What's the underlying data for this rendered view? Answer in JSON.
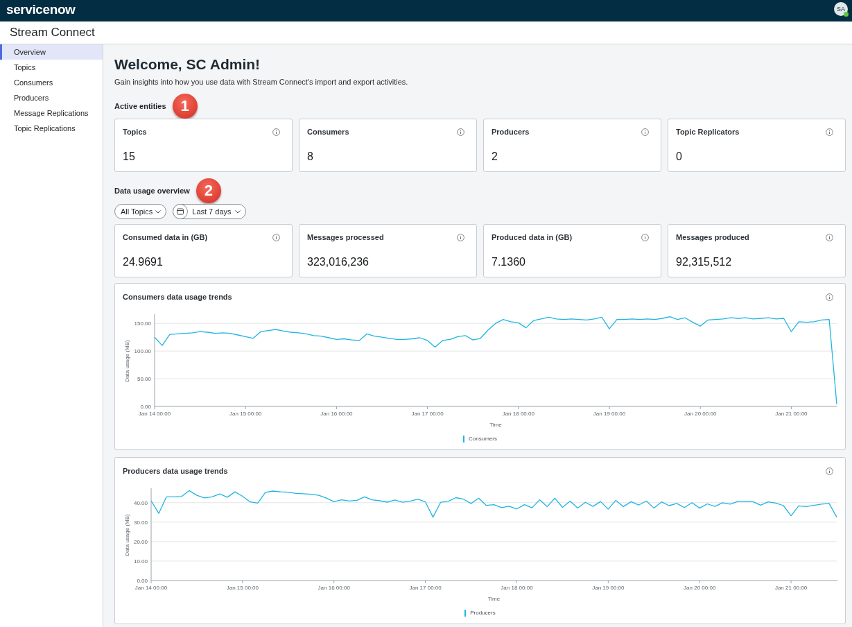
{
  "top_bar": {
    "logo": "servicenow",
    "avatar": {
      "initials": "SA",
      "online": true
    }
  },
  "app_header": {
    "title": "Stream Connect"
  },
  "sidebar": {
    "items": [
      {
        "label": "Overview",
        "selected": true
      },
      {
        "label": "Topics",
        "selected": false
      },
      {
        "label": "Consumers",
        "selected": false
      },
      {
        "label": "Producers",
        "selected": false
      },
      {
        "label": "Message Replications",
        "selected": false
      },
      {
        "label": "Topic Replications",
        "selected": false
      }
    ]
  },
  "main": {
    "title": "Welcome, SC Admin!",
    "subtitle": "Gain insights into how you use data with Stream Connect's import and export activities.",
    "sections": [
      {
        "heading": "Active entities",
        "callout": "1",
        "cards": [
          {
            "label": "Topics",
            "value": "15"
          },
          {
            "label": "Consumers",
            "value": "8"
          },
          {
            "label": "Producers",
            "value": "2"
          },
          {
            "label": "Topic Replicators",
            "value": "0"
          }
        ]
      },
      {
        "heading": "Data usage overview",
        "callout": "2",
        "filters": [
          {
            "kind": "dropdown",
            "label": "All Topics"
          },
          {
            "kind": "date",
            "label": "Last 7 days"
          }
        ],
        "cards": [
          {
            "label": "Consumed data in (GB)",
            "value": "24.9691"
          },
          {
            "label": "Messages processed",
            "value": "323,016,236"
          },
          {
            "label": "Produced data in (GB)",
            "value": "7.1360"
          },
          {
            "label": "Messages produced",
            "value": "92,315,512"
          }
        ],
        "charts": [
          {
            "chart_data": {
              "type": "line",
              "title": "Consumers data usage trends",
              "xlabel": "Time",
              "ylabel": "Data usage (MB)",
              "grid": true,
              "categories": [
                "Jan 14 00:00",
                null,
                null,
                null,
                null,
                null,
                null,
                null,
                null,
                null,
                null,
                null,
                "Jan 15 00:00",
                null,
                null,
                null,
                null,
                null,
                null,
                null,
                null,
                null,
                null,
                null,
                "Jan 16 00:00",
                null,
                null,
                null,
                null,
                null,
                null,
                null,
                null,
                null,
                null,
                null,
                "Jan 17 00:00",
                null,
                null,
                null,
                null,
                null,
                null,
                null,
                null,
                null,
                null,
                null,
                "Jan 18 00:00",
                null,
                null,
                null,
                null,
                null,
                null,
                null,
                null,
                null,
                null,
                null,
                "Jan 19 00:00",
                null,
                null,
                null,
                null,
                null,
                null,
                null,
                null,
                null,
                null,
                null,
                "Jan 20 00:00",
                null,
                null,
                null,
                null,
                null,
                null,
                null,
                null,
                null,
                null,
                null,
                "Jan 21 00:00",
                null,
                null,
                null,
                null,
                null,
                null
              ],
              "series": [
                {
                  "name": "Consumers",
                  "color": "#1fb5e2",
                  "values": [
                    125,
                    110,
                    130,
                    131,
                    132,
                    133,
                    135,
                    134,
                    132,
                    133,
                    132,
                    129,
                    126,
                    123,
                    135,
                    137,
                    139,
                    136,
                    134,
                    133,
                    131,
                    128,
                    127,
                    124,
                    121,
                    122,
                    120,
                    119,
                    131,
                    127,
                    125,
                    123,
                    121,
                    121,
                    122,
                    124,
                    119,
                    107,
                    119,
                    121,
                    126,
                    128,
                    120,
                    123,
                    138,
                    150,
                    157,
                    153,
                    151,
                    142,
                    155,
                    158,
                    161,
                    158,
                    157,
                    158,
                    157,
                    156,
                    158,
                    161,
                    140,
                    157,
                    157,
                    158,
                    157,
                    158,
                    157,
                    159,
                    162,
                    157,
                    160,
                    152,
                    145,
                    156,
                    157,
                    158,
                    160,
                    159,
                    160,
                    158,
                    159,
                    160,
                    158,
                    159,
                    135,
                    153,
                    152,
                    153,
                    156,
                    157,
                    4
                  ]
                }
              ],
              "ylim": [
                0,
                164
              ],
              "yticks": [
                {
                  "value": 0,
                  "label": "0.00"
                },
                {
                  "value": 50,
                  "label": "50.00"
                },
                {
                  "value": 100,
                  "label": "100.00"
                },
                {
                  "value": 150,
                  "label": "150.00"
                }
              ]
            }
          },
          {
            "chart_data": {
              "type": "line",
              "title": "Producers data usage trends",
              "xlabel": "Time",
              "ylabel": "Data usage (MB)",
              "grid": true,
              "categories": [
                "Jan 14 00:00",
                null,
                null,
                null,
                null,
                null,
                null,
                null,
                null,
                null,
                null,
                null,
                "Jan 15 00:00",
                null,
                null,
                null,
                null,
                null,
                null,
                null,
                null,
                null,
                null,
                null,
                "Jan 16 00:00",
                null,
                null,
                null,
                null,
                null,
                null,
                null,
                null,
                null,
                null,
                null,
                "Jan 17 00:00",
                null,
                null,
                null,
                null,
                null,
                null,
                null,
                null,
                null,
                null,
                null,
                "Jan 18 00:00",
                null,
                null,
                null,
                null,
                null,
                null,
                null,
                null,
                null,
                null,
                null,
                "Jan 19 00:00",
                null,
                null,
                null,
                null,
                null,
                null,
                null,
                null,
                null,
                null,
                null,
                "Jan 20 00:00",
                null,
                null,
                null,
                null,
                null,
                null,
                null,
                null,
                null,
                null,
                null,
                "Jan 21 00:00",
                null,
                null,
                null,
                null,
                null,
                null
              ],
              "series": [
                {
                  "name": "Producers",
                  "color": "#1fb5e2",
                  "values": [
                    41.0,
                    34.5,
                    43.0,
                    43.0,
                    43.2,
                    46.2,
                    43.8,
                    42.5,
                    43.0,
                    44.5,
                    42.8,
                    45.6,
                    43.3,
                    40.4,
                    39.8,
                    45.3,
                    46.0,
                    45.6,
                    45.4,
                    44.8,
                    44.6,
                    44.3,
                    43.8,
                    42.4,
                    40.5,
                    41.5,
                    40.9,
                    41.2,
                    43.0,
                    41.5,
                    41.0,
                    40.3,
                    41.4,
                    40.2,
                    40.8,
                    41.8,
                    40.4,
                    32.6,
                    40.2,
                    40.7,
                    42.6,
                    41.8,
                    39.6,
                    42.3,
                    38.6,
                    39.0,
                    37.5,
                    38.2,
                    36.8,
                    39.0,
                    37.4,
                    41.5,
                    38.0,
                    42.3,
                    37.6,
                    40.8,
                    37.3,
                    40.2,
                    38.1,
                    40.6,
                    36.7,
                    41.2,
                    38.0,
                    40.5,
                    38.8,
                    40.9,
                    37.2,
                    40.4,
                    38.5,
                    39.6,
                    37.5,
                    40.0,
                    37.2,
                    39.4,
                    38.1,
                    40.0,
                    39.3,
                    40.6,
                    40.6,
                    40.5,
                    38.7,
                    40.4,
                    39.8,
                    38.5,
                    33.3,
                    38.4,
                    38.0,
                    38.6,
                    39.3,
                    39.6,
                    32.6
                  ]
                }
              ],
              "ylim": [
                0,
                46.7
              ],
              "yticks": [
                {
                  "value": 0,
                  "label": "0.00"
                },
                {
                  "value": 10,
                  "label": "10.00"
                },
                {
                  "value": 20,
                  "label": "20.00"
                },
                {
                  "value": 30,
                  "label": "30.00"
                },
                {
                  "value": 40,
                  "label": "40.00"
                }
              ]
            }
          }
        ]
      }
    ]
  }
}
